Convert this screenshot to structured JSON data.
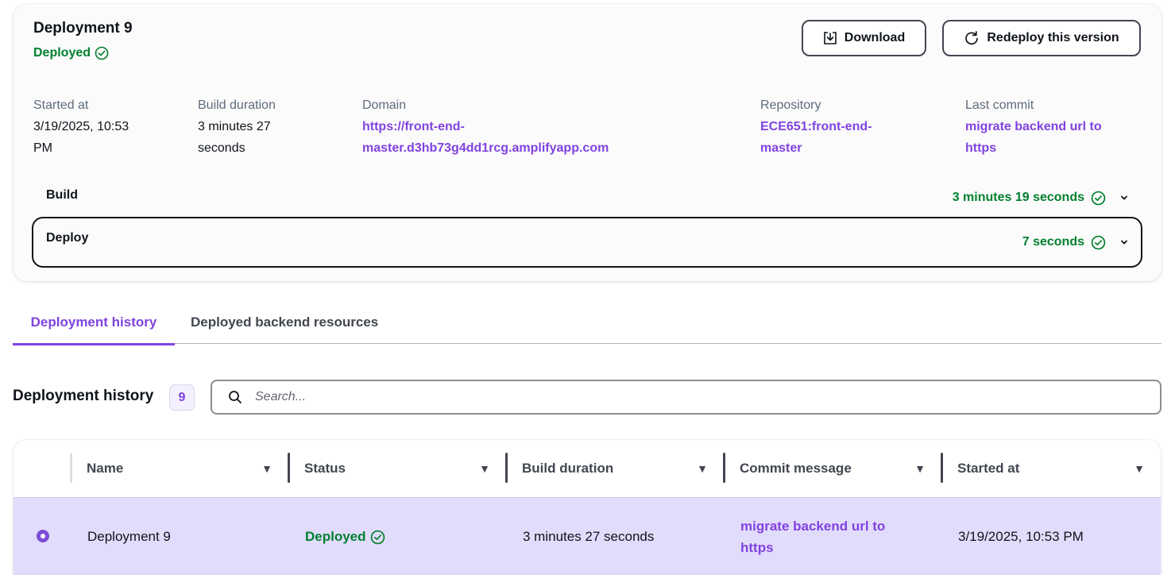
{
  "deployment": {
    "title": "Deployment 9",
    "status": "Deployed",
    "download_label": "Download",
    "redeploy_label": "Redeploy this version",
    "started_at": {
      "label": "Started at",
      "value_line1": "3/19/2025, 10:53",
      "value_line2": "PM"
    },
    "build_duration": {
      "label": "Build duration",
      "value_line1": "3 minutes 27",
      "value_line2": "seconds"
    },
    "domain": {
      "label": "Domain",
      "value_line1": "https://front-end-",
      "value_line2": "master.d3hb73g4dd1rcg.amplifyapp.com"
    },
    "repository": {
      "label": "Repository",
      "value_line1": "ECE651:front-end-",
      "value_line2": "master"
    },
    "last_commit": {
      "label": "Last commit",
      "value_line1": "migrate backend url to",
      "value_line2": "https"
    },
    "steps": [
      {
        "label": "Build",
        "duration": "3 minutes 19 seconds"
      },
      {
        "label": "Deploy",
        "duration": "7 seconds"
      }
    ]
  },
  "tabs": [
    {
      "label": "Deployment history",
      "active": true
    },
    {
      "label": "Deployed backend resources",
      "active": false
    }
  ],
  "history": {
    "title": "Deployment history",
    "count": "9",
    "search_placeholder": "Search...",
    "columns": [
      "Name",
      "Status",
      "Build duration",
      "Commit message",
      "Started at"
    ],
    "rows": [
      {
        "selected": true,
        "name": "Deployment 9",
        "status": "Deployed",
        "build_duration": "3 minutes 27 seconds",
        "commit_line1": "migrate backend url to",
        "commit_line2": "https",
        "started_at": "3/19/2025, 10:53 PM"
      }
    ]
  },
  "colors": {
    "accent": "#8043e0",
    "success": "#00802f",
    "selected_row": "#e2dcfc"
  }
}
